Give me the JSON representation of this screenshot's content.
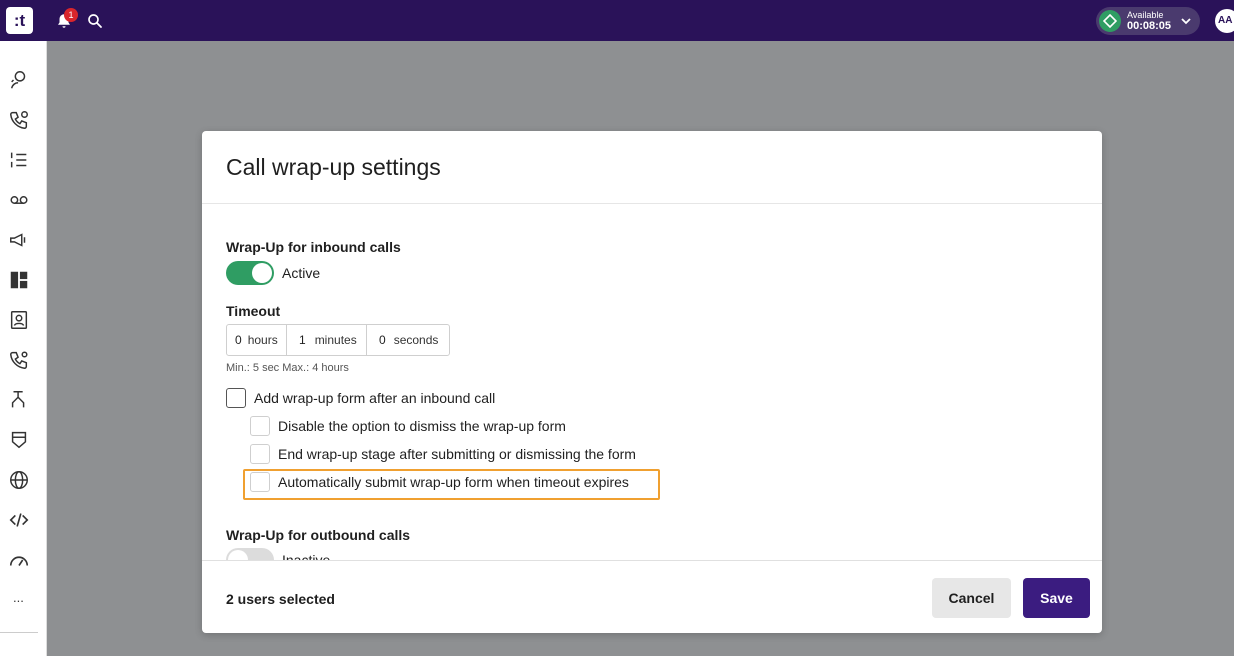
{
  "topbar": {
    "logo_text": ":t",
    "notifications_count": "1",
    "status_label": "Available",
    "status_time": "00:08:05",
    "avatar_initials": "AA"
  },
  "colors": {
    "topbar": "#2a1259",
    "accent_green": "#2f9d63",
    "primary_button": "#3b1c80",
    "highlight": "#f0a030"
  },
  "sidebar": {
    "items": [
      {
        "icon": "agent-icon"
      },
      {
        "icon": "phone-clock-icon"
      },
      {
        "icon": "list-numbered-icon"
      },
      {
        "icon": "voicemail-icon"
      },
      {
        "icon": "megaphone-icon"
      },
      {
        "icon": "dashboard-icon"
      },
      {
        "icon": "contacts-book-icon"
      },
      {
        "icon": "phone-settings-icon"
      },
      {
        "icon": "routing-icon"
      },
      {
        "icon": "shield-icon"
      },
      {
        "icon": "globe-icon"
      },
      {
        "icon": "code-icon"
      },
      {
        "icon": "gauge-icon"
      }
    ],
    "more_label": "..."
  },
  "modal": {
    "title": "Call wrap-up settings",
    "inbound": {
      "section_label": "Wrap-Up for inbound calls",
      "toggle_label": "Active",
      "timeout_label": "Timeout",
      "hours_value": "0",
      "hours_unit": "hours",
      "minutes_value": "1",
      "minutes_unit": "minutes",
      "seconds_value": "0",
      "seconds_unit": "seconds",
      "hint": "Min.: 5 sec Max.: 4 hours",
      "add_form_label": "Add wrap-up form after an inbound call",
      "disable_dismiss_label": "Disable the option to dismiss the wrap-up form",
      "end_stage_label": "End wrap-up stage after submitting or dismissing the form",
      "auto_submit_label": "Automatically submit wrap-up form when timeout expires"
    },
    "outbound": {
      "section_label": "Wrap-Up for outbound calls",
      "toggle_label": "Inactive"
    },
    "footer": {
      "selected_text": "2 users selected",
      "cancel_label": "Cancel",
      "save_label": "Save"
    }
  }
}
